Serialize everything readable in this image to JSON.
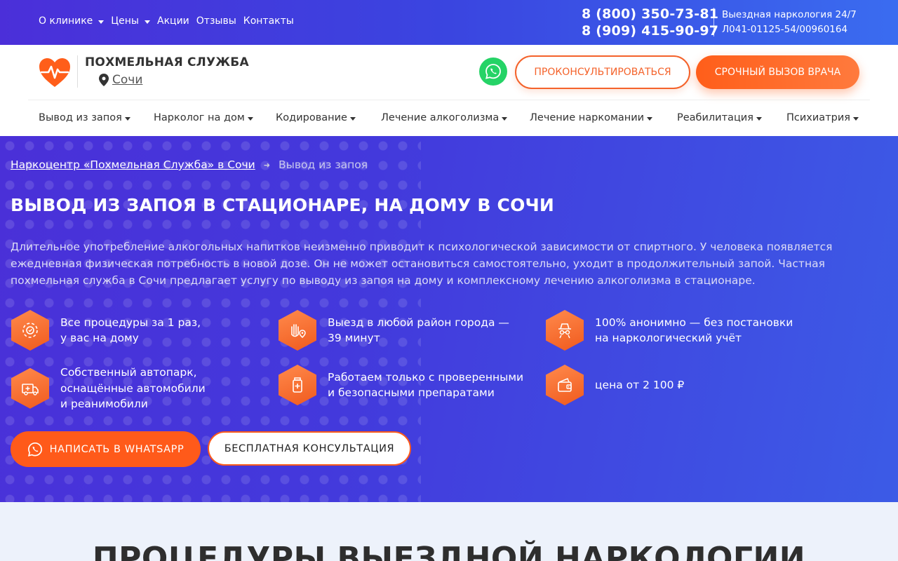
{
  "topbar": {
    "nav": [
      {
        "label": "О клинике",
        "has_dropdown": true
      },
      {
        "label": "Цены",
        "has_dropdown": true
      },
      {
        "label": "Акции",
        "has_dropdown": false
      },
      {
        "label": "Отзывы",
        "has_dropdown": false
      },
      {
        "label": "Контакты",
        "has_dropdown": false
      }
    ],
    "phones": [
      "8 (800) 350-73-81",
      "8 (909) 415-90-97"
    ],
    "info_line1": "Выездная наркология 24/7",
    "info_line2": "Л041-01125-54/00960164"
  },
  "header": {
    "brand": "ПОХМЕЛЬНАЯ СЛУЖБА",
    "city": "Сочи",
    "consult_button": "ПРОКОНСУЛЬТИРОВАТЬСЯ",
    "urgent_button": "СРОЧНЫЙ ВЫЗОВ ВРАЧА"
  },
  "mainnav": [
    "Вывод из запоя",
    "Нарколог на дом",
    "Кодирование",
    "Лечение алкоголизма",
    "Лечение наркомании",
    "Реабилитация",
    "Психиатрия"
  ],
  "hero": {
    "breadcrumb_home": "Наркоцентр «Похмельная Служба» в Сочи",
    "breadcrumb_current": "Вывод из запоя",
    "title": "ВЫВОД ИЗ ЗАПОЯ В СТАЦИОНАРЕ, НА ДОМУ В СОЧИ",
    "intro": "Длительное употребление алкогольных напитков неизменно приводит к психологической зависимости от спиртного. У человека появляется ежедневная физическая потребность в новой дозе. Он не может остановиться самостоятельно, уходит в продолжительный запой. Частная похмельная служба в Сочи предлагает услугу по выводу из запоя на дому и комплексному лечению алкоголизма в стационаре.",
    "features": [
      {
        "icon": "gear-icon",
        "text": "Все процедуры за 1 раз,\nу вас на дому"
      },
      {
        "icon": "hand-location-icon",
        "text": "Выезд в любой район города —\n39 минут"
      },
      {
        "icon": "incognito-icon",
        "text": "100% анонимно — без постановки\nна наркологический учёт"
      },
      {
        "icon": "ambulance-icon",
        "text": "Собственный автопарк,\nоснащённые автомобили\nи реанимобили"
      },
      {
        "icon": "medicine-bottle-icon",
        "text": "Работаем только с проверенными\nи безопасными препаратами"
      },
      {
        "icon": "wallet-icon",
        "text": "цена от 2 100 ₽"
      }
    ],
    "whatsapp_button": "НАПИСАТЬ В WHATSAPP",
    "free_consult_button": "БЕСПЛАТНАЯ КОНСУЛЬТАЦИЯ"
  },
  "procedures": {
    "title": "ПРОЦЕДУРЫ ВЫЕЗДНОЙ НАРКОЛОГИИ"
  },
  "colors": {
    "accent_orange": "#ff5a1a",
    "hero_blue": "#4339dc",
    "whatsapp_green": "#25d366"
  }
}
